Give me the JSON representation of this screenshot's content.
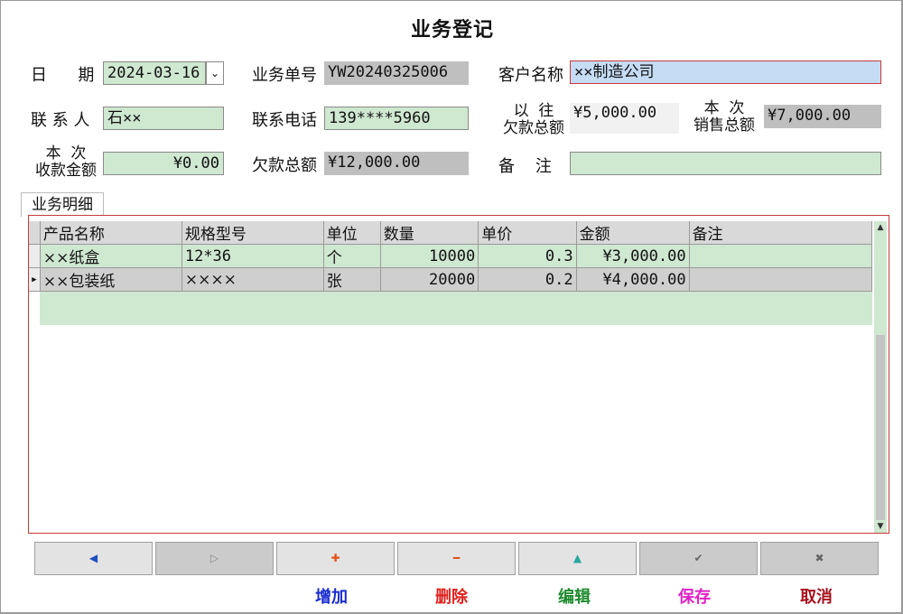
{
  "title": "业务登记",
  "fields": {
    "date_label": "日      期",
    "date_value": "2024-03-16",
    "date_dropdown": "⌄",
    "order_no_label": "业务单号",
    "order_no_value": "YW20240325006",
    "customer_label": "客户名称",
    "customer_value": "××制造公司",
    "contact_label": "联 系 人",
    "contact_value": "石××",
    "phone_label": "联系电话",
    "phone_value": "139****5960",
    "prev_debt_label_1": "以  往",
    "prev_debt_label_2": "欠款总额",
    "prev_debt_value": "¥5,000.00",
    "sales_total_label_1": "本  次",
    "sales_total_label_2": "销售总额",
    "sales_total_value": "¥7,000.00",
    "received_label_1": "本  次",
    "received_label_2": "收款金额",
    "received_value": "¥0.00",
    "debt_total_label": "欠款总额",
    "debt_total_value": "¥12,000.00",
    "remark_label": "备    注",
    "remark_value": ""
  },
  "tab": "业务明细",
  "grid": {
    "columns": [
      "产品名称",
      "规格型号",
      "单位",
      "数量",
      "单价",
      "金额",
      "备注"
    ],
    "rows": [
      {
        "selector": "",
        "name": "××纸盒",
        "spec": "12*36",
        "unit": "个",
        "qty": "10000",
        "price": "0.3",
        "amount": "¥3,000.00",
        "remark": ""
      },
      {
        "selector": "▶",
        "name": "××包装纸",
        "spec": "××××",
        "unit": "张",
        "qty": "20000",
        "price": "0.2",
        "amount": "¥4,000.00",
        "remark": ""
      }
    ]
  },
  "nav_buttons": [
    "◀",
    "▷",
    "✚",
    "━",
    "▲",
    "✔",
    "✖"
  ],
  "nav_colors": [
    "#1f4fbf",
    "#888888",
    "#e0521c",
    "#e0521c",
    "#2aa6a0",
    "#666666",
    "#666666"
  ],
  "actions": [
    {
      "label": "增加",
      "color": "#1a2bd1"
    },
    {
      "label": "删除",
      "color": "#e0201c"
    },
    {
      "label": "编辑",
      "color": "#1e8a2e"
    },
    {
      "label": "保存",
      "color": "#e020c8"
    },
    {
      "label": "取消",
      "color": "#a8101c"
    }
  ]
}
